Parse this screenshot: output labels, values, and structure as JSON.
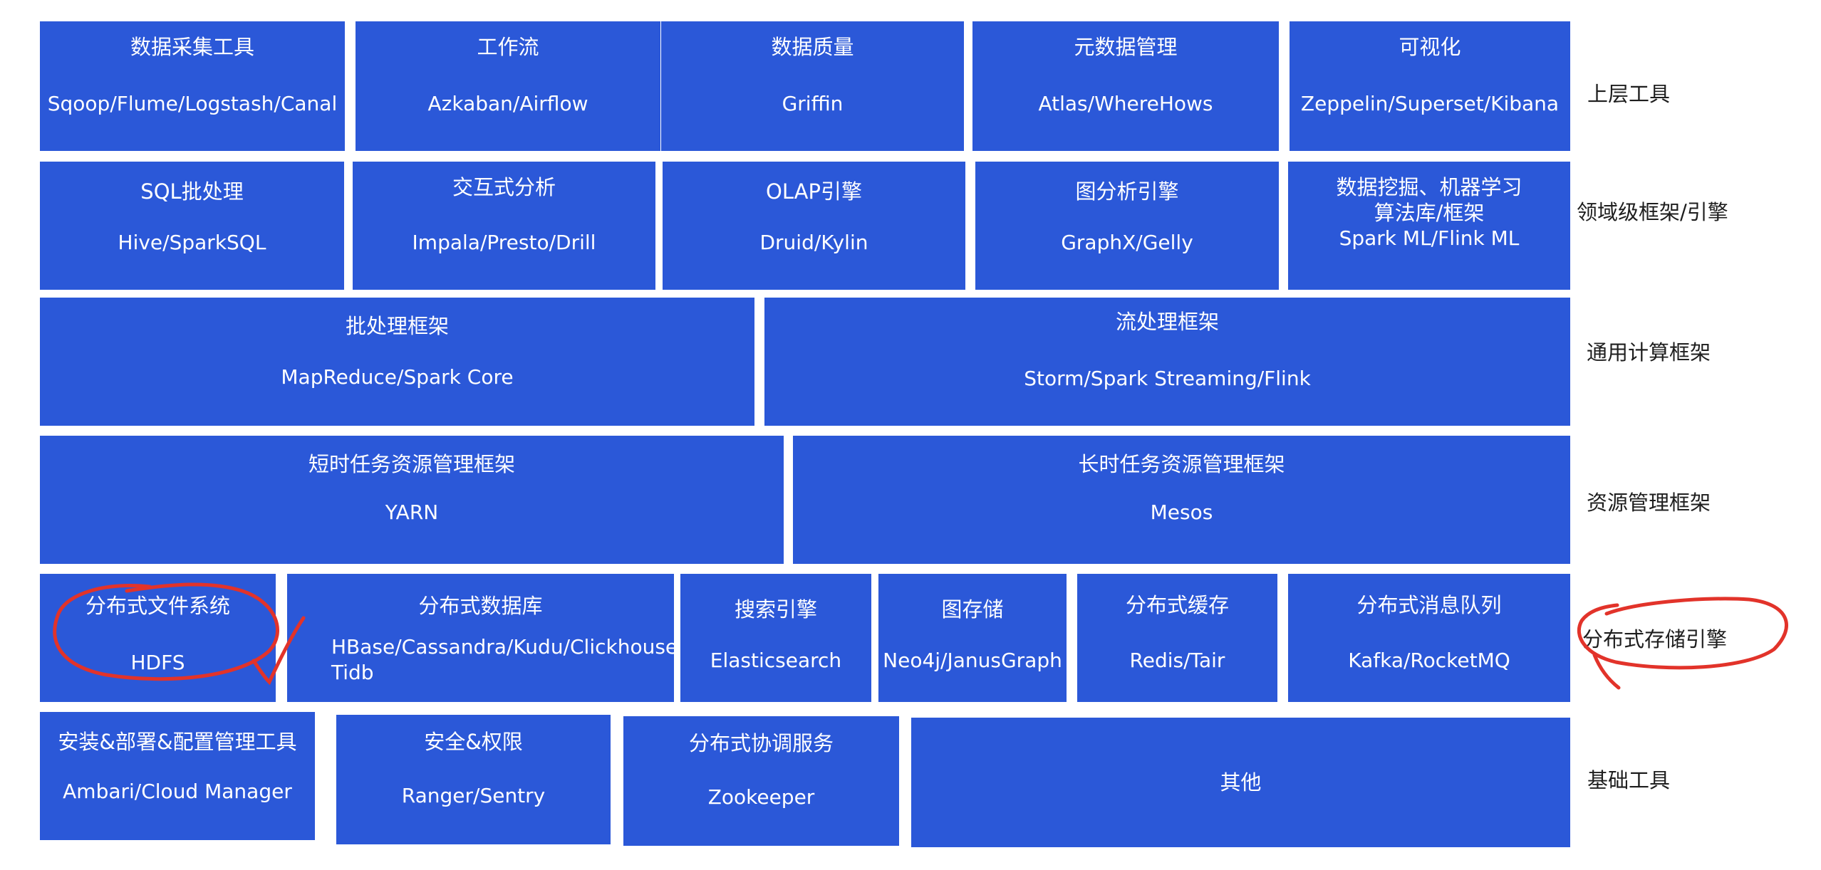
{
  "layers": {
    "l1": "上层工具",
    "l2": "领域级框架/引擎",
    "l3": "通用计算框架",
    "l4": "资源管理框架",
    "l5": "分布式存储引擎",
    "l6": "基础工具"
  },
  "row1": {
    "b1": {
      "title": "数据采集工具",
      "tools": "Sqoop/Flume/Logstash/Canal"
    },
    "b2": {
      "title": "工作流",
      "tools": "Azkaban/Airflow"
    },
    "b3": {
      "title": "数据质量",
      "tools": "Griffin"
    },
    "b4": {
      "title": "元数据管理",
      "tools": "Atlas/WhereHows"
    },
    "b5": {
      "title": "可视化",
      "tools": "Zeppelin/Superset/Kibana"
    }
  },
  "row2": {
    "b1": {
      "title": "SQL批处理",
      "tools": "Hive/SparkSQL"
    },
    "b2": {
      "title": "交互式分析",
      "tools": "Impala/Presto/Drill"
    },
    "b3": {
      "title": "OLAP引擎",
      "tools": "Druid/Kylin"
    },
    "b4": {
      "title": "图分析引擎",
      "tools": "GraphX/Gelly"
    },
    "b5": {
      "title1": "数据挖掘、机器学习",
      "title2": "算法库/框架",
      "tools": "Spark ML/Flink ML"
    }
  },
  "row3": {
    "b1": {
      "title": "批处理框架",
      "tools": "MapReduce/Spark Core"
    },
    "b2": {
      "title": "流处理框架",
      "tools": "Storm/Spark Streaming/Flink"
    }
  },
  "row4": {
    "b1": {
      "title": "短时任务资源管理框架",
      "tools": "YARN"
    },
    "b2": {
      "title": "长时任务资源管理框架",
      "tools": "Mesos"
    }
  },
  "row5": {
    "b1": {
      "title": "分布式文件系统",
      "tools": "HDFS"
    },
    "b2": {
      "title": "分布式数据库",
      "tools1": "HBase/Cassandra/Kudu/Clickhouse",
      "tools2": "Tidb"
    },
    "b3": {
      "title": "搜索引擎",
      "tools": "Elasticsearch"
    },
    "b4": {
      "title": "图存储",
      "tools": "Neo4j/JanusGraph"
    },
    "b5": {
      "title": "分布式缓存",
      "tools": "Redis/Tair"
    },
    "b6": {
      "title": "分布式消息队列",
      "tools": "Kafka/RocketMQ"
    }
  },
  "row6": {
    "b1": {
      "title": "安装&部署&配置管理工具",
      "tools": "Ambari/Cloud Manager"
    },
    "b2": {
      "title": "安全&权限",
      "tools": "Ranger/Sentry"
    },
    "b3": {
      "title": "分布式协调服务",
      "tools": "Zookeeper"
    },
    "b4": {
      "title": "其他"
    }
  },
  "colors": {
    "box": "#2b58d8",
    "annotation": "#e2332a",
    "text": "#ffffff"
  }
}
